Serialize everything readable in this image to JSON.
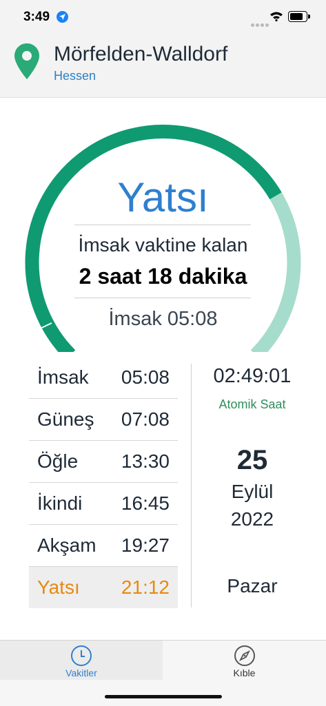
{
  "status": {
    "time": "3:49"
  },
  "location": {
    "city": "Mörfelden-Walldorf",
    "region": "Hessen"
  },
  "countdown": {
    "current_prayer": "Yatsı",
    "next_label": "İmsak vaktine kalan",
    "remaining": "2 saat 18 dakika",
    "next_time": "İmsak 05:08",
    "progress": 0.72,
    "colors": {
      "elapsed": "#0f9a72",
      "remaining": "#a6dccb"
    }
  },
  "prayers": [
    {
      "name": "İmsak",
      "time": "05:08"
    },
    {
      "name": "Güneş",
      "time": "07:08"
    },
    {
      "name": "Öğle",
      "time": "13:30"
    },
    {
      "name": "İkindi",
      "time": "16:45"
    },
    {
      "name": "Akşam",
      "time": "19:27"
    },
    {
      "name": "Yatsı",
      "time": "21:12"
    }
  ],
  "clock": {
    "time": "02:49:01",
    "label": "Atomik Saat"
  },
  "date": {
    "day": "25",
    "month": "Eylül",
    "year": "2022",
    "weekday": "Pazar"
  },
  "tabs": [
    {
      "label": "Vakitler",
      "icon": "clock-icon"
    },
    {
      "label": "Kıble",
      "icon": "compass-icon"
    }
  ],
  "colors": {
    "accent": "#2e7fcf",
    "active_prayer": "#e8890f",
    "green": "#2f8e5b"
  }
}
